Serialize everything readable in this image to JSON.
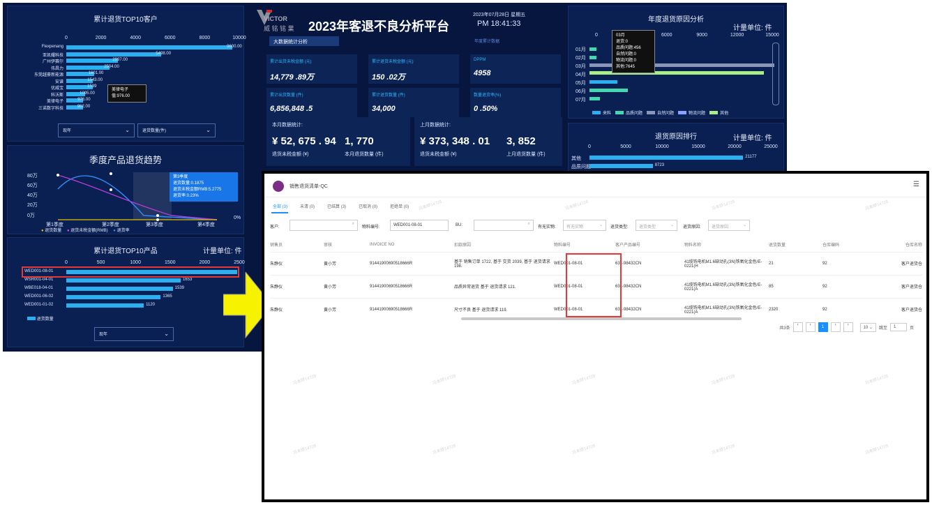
{
  "top10_customers": {
    "title": "累计退货TOP10客户",
    "axis": [
      "0",
      "2000",
      "4000",
      "6000",
      "8000",
      "10000"
    ],
    "rows": [
      {
        "name": "Flexpenang",
        "value": 9600,
        "label": "9600.00"
      },
      {
        "name": "亚凯耀科技",
        "value": 5498,
        "label": "5498.00"
      },
      {
        "name": "广州伊赛尔",
        "value": 2997,
        "label": "2997.00"
      },
      {
        "name": "伟昌力",
        "value": 2504,
        "label": "2504.00"
      },
      {
        "name": "东莞越豪新能源",
        "value": 1601,
        "label": "1601.00"
      },
      {
        "name": "安谱",
        "value": 1543,
        "label": "1543.00"
      },
      {
        "name": "优威宝",
        "value": 1539,
        "label": "1539"
      },
      {
        "name": "科沃斯",
        "value": 1095,
        "label": "1095.00"
      },
      {
        "name": "美律电子",
        "value": 976,
        "label": "976.00"
      },
      {
        "name": "三诺数字科技",
        "value": 962,
        "label": "962.00"
      }
    ],
    "tooltip_name": "美律电子",
    "tooltip_val": "值:976.00",
    "select1": "现年",
    "select2": "退货数量(件)"
  },
  "season": {
    "title": "季度产品退货趋势",
    "yticks": [
      "80万",
      "60万",
      "40万",
      "20万",
      "0万"
    ],
    "ry": [
      "0%"
    ],
    "xticks": [
      "第1季度",
      "第2季度",
      "第3季度",
      "第4季度"
    ],
    "legend": [
      "退货数量",
      "退货未税金额(RMB)",
      "退货率"
    ],
    "tip_title": "第3季度",
    "tip1": "退货数量:0.1875",
    "tip2": "退货未税金额RMB:5.2775",
    "tip3": "退货率:0.23%"
  },
  "top10_products": {
    "title": "累计退货TOP10产品",
    "unit": "计量单位: 件",
    "axis": [
      "0",
      "500",
      "1000",
      "1500",
      "2000",
      "2500"
    ],
    "rows": [
      {
        "name": "WED001-08-01",
        "value": 2470,
        "label": ""
      },
      {
        "name": "WSR001-04-01",
        "value": 1653,
        "label": "1653"
      },
      {
        "name": "WBE018-04-01",
        "value": 1539,
        "label": "1539"
      },
      {
        "name": "WED001-06-02",
        "value": 1365,
        "label": "1365"
      },
      {
        "name": "WED001-01-02",
        "value": 1120,
        "label": "1120"
      }
    ],
    "legend": "退货数量",
    "select": "现年"
  },
  "header": {
    "logo_text": "VICTOR",
    "logo_cn": "威 铭 铭 業",
    "title": "2023年客退不良分析平台",
    "date": "2023年07月28日 星期五",
    "time": "PM 18:41:33",
    "tab1": "大数据统计分析",
    "tab2": "年度累计数据"
  },
  "kpis": [
    {
      "t": "累计出货未税金额 (元)",
      "v": "14,779 .89万"
    },
    {
      "t": "累计退货未税金额 (元)",
      "v": "150 .02万"
    },
    {
      "t": "DPPM",
      "v": "4958"
    },
    {
      "t": "累计出货数量 (件)",
      "v": "6,856,848 .5"
    },
    {
      "t": "累计退货数量 (件)",
      "v": "34,000"
    },
    {
      "t": "数量退货率(%)",
      "v": "0 .50%"
    }
  ],
  "month": {
    "this_title": "本月数据统计:",
    "this_amt": "¥ 52, 675 . 94",
    "this_qty": "1, 770",
    "this_amt_lbl": "退货未税金额 (¥)",
    "this_qty_lbl": "本月退货数量 (件)",
    "last_title": "上月数据统计:",
    "last_amt": "¥ 373, 348 . 01",
    "last_qty": "3, 852",
    "last_amt_lbl": "退货未税金额 (¥)",
    "last_qty_lbl": "上月退货数量 (件)"
  },
  "reason_analysis": {
    "title": "年度退货原因分析",
    "unit": "计量单位: 件",
    "axis": [
      "0",
      "3000",
      "6000",
      "9000",
      "12000",
      "15000"
    ],
    "months": [
      "01月",
      "02月",
      "03月",
      "04月",
      "05月",
      "06月",
      "07月"
    ],
    "legend": [
      "来料",
      "品质问题",
      "自然问题",
      "物流问题",
      "其他"
    ],
    "tip": [
      "03月",
      "退货:0",
      "品质问题:456",
      "自然问题:0",
      "物流问题:0",
      "其他:7645"
    ],
    "colors": [
      "#2ab0f0",
      "#44d8b0",
      "#8a96b8",
      "#8da0ff",
      "#a8ee88"
    ]
  },
  "reason_rank": {
    "title": "退货原因排行",
    "unit": "计量单位: 件",
    "axis": [
      "0",
      "5000",
      "10000",
      "15000",
      "20000",
      "25000"
    ],
    "rows": [
      {
        "name": "其他",
        "value": 21177,
        "label": "21177"
      },
      {
        "name": "品质问题",
        "value": 8723,
        "label": "8723"
      }
    ]
  },
  "window": {
    "title": "销售退货清单-QC",
    "tabs": [
      "全部 (3)",
      "未清 (0)",
      "已结算 (3)",
      "已取消 (0)",
      "拒绝单 (0)"
    ],
    "filters": {
      "customer_label": "客户:",
      "material_label": "物料编号:",
      "material_value": "WED001-08-01",
      "bu_label": "BU:",
      "valid_label": "有无实物:",
      "valid_value": "有无实物",
      "type_label": "退货类型:",
      "type_value": "退货类型",
      "reason_label": "退货原因:",
      "reason_value": "退货原因"
    },
    "columns": [
      "销售员",
      "审核",
      "INVOICE NO",
      "扣款原因",
      "物料编号",
      "客户产品编号",
      "物料名称",
      "退货数量",
      "仓库编码",
      "仓库名称"
    ],
    "rows": [
      [
        "朱静仪",
        "黄小芳",
        "91441900690518666R",
        "基于 销售订单 1722, 基于 交货 2039, 基于 退货请求 198.",
        "WED001-08-01",
        "631-98432CN",
        "41缆铣电机M1.6缺动孔(3N)铁氧化金色/E-0221(H",
        "21",
        "92",
        "客户退货仓"
      ],
      [
        "朱静仪",
        "黄小芳",
        "91441900690518666R",
        "品质异常退货 基于 退货请求 121.",
        "WED001-08-01",
        "631-98432CN",
        "41缆铣电机M1.6缺动孔(3N)铁氧化金色/E-0221(A",
        "85",
        "92",
        "客户退货仓"
      ],
      [
        "朱静仪",
        "黄小芳",
        "91441900690518666R",
        "尺寸不良 基于 退货请求 119.",
        "WED001-08-01",
        "631-98432CN",
        "41缆铣电机M1.6缺动孔(3N)铁氧化金色/E-0221(A",
        "2320",
        "92",
        "客户退货仓"
      ]
    ],
    "pagination": {
      "total": "共3条",
      "current": "1",
      "page_size": "10",
      "goto_label": "跳至",
      "goto_value": "1",
      "page_suffix": "页"
    },
    "watermark": "冯本婷14728"
  }
}
